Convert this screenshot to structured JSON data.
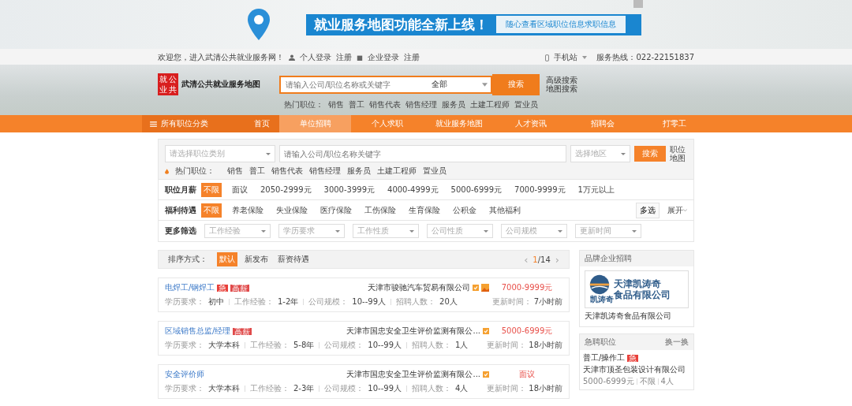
{
  "banner": {
    "headline": "就业服务地图功能全新上线！",
    "subline": "随心查看区域职位信息求职信息"
  },
  "topbar": {
    "welcome": "欢迎您，进入武清公共就业服务网！",
    "links": [
      {
        "label": "个人登录",
        "kind": "person"
      },
      {
        "label": "注册",
        "kind": "plain"
      },
      {
        "label": "企业登录",
        "kind": "company"
      },
      {
        "label": "注册",
        "kind": "plain"
      }
    ],
    "mobile": "手机站",
    "hotline": "服务热线：022-22151837"
  },
  "header": {
    "logo_chars": [
      "就",
      "公",
      "业",
      "共"
    ],
    "site_name": "武清公共就业服务地图",
    "search_placeholder": "请输入公司/职位名称或关键字",
    "scope": "全部",
    "search_button": "搜索",
    "links": [
      "高级搜索",
      "地图搜索"
    ],
    "hot_label": "热门职位：",
    "hot_tags": [
      "销售",
      "普工",
      "销售代表",
      "销售经理",
      "服务员",
      "土建工程师",
      "置业员"
    ]
  },
  "nav": {
    "category": "所有职位分类",
    "items": [
      {
        "label": "首页",
        "selected": false
      },
      {
        "label": "单位招聘",
        "selected": true
      },
      {
        "label": "个人求职",
        "selected": false
      },
      {
        "label": "就业服务地图",
        "selected": false
      },
      {
        "label": "人才资讯",
        "selected": false
      },
      {
        "label": "招聘会",
        "selected": false
      },
      {
        "label": "打零工",
        "selected": false
      }
    ]
  },
  "filters": {
    "category_placeholder": "请选择职位类别",
    "keyword_placeholder": "请输入公司/职位名称关键字",
    "region_placeholder": "选择地区",
    "search_button": "搜索",
    "map_link": "职位地图",
    "hot_label": "热门职位：",
    "hot_tags": [
      "销售",
      "普工",
      "销售代表",
      "销售经理",
      "服务员",
      "土建工程师",
      "置业员"
    ],
    "salary": {
      "label": "职位月薪",
      "options": [
        {
          "label": "不限",
          "selected": true
        },
        {
          "label": "面议",
          "selected": false
        },
        {
          "label": "2050-2999元",
          "selected": false
        },
        {
          "label": "3000-3999元",
          "selected": false
        },
        {
          "label": "4000-4999元",
          "selected": false
        },
        {
          "label": "5000-6999元",
          "selected": false
        },
        {
          "label": "7000-9999元",
          "selected": false
        },
        {
          "label": "1万元以上",
          "selected": false
        }
      ]
    },
    "welfare": {
      "label": "福利待遇",
      "options": [
        {
          "label": "不限",
          "selected": true
        },
        {
          "label": "养老保险",
          "selected": false
        },
        {
          "label": "失业保险",
          "selected": false
        },
        {
          "label": "医疗保险",
          "selected": false
        },
        {
          "label": "工伤保险",
          "selected": false
        },
        {
          "label": "生育保险",
          "selected": false
        },
        {
          "label": "公积金",
          "selected": false
        },
        {
          "label": "其他福利",
          "selected": false
        }
      ],
      "multi": "多选",
      "expand": "展开"
    },
    "more": {
      "label": "更多筛选",
      "selects": [
        "工作经验",
        "学历要求",
        "工作性质",
        "公司性质",
        "公司规模",
        "更新时间"
      ]
    }
  },
  "sort": {
    "label": "排序方式：",
    "options": [
      {
        "label": "默认",
        "selected": true
      },
      {
        "label": "新发布",
        "selected": false
      },
      {
        "label": "薪资待遇",
        "selected": false
      }
    ],
    "prev": "‹",
    "page_current": "1",
    "page_total": "/14",
    "next": "›"
  },
  "jobs": [
    {
      "title": "电焊工/钢焊工",
      "badges": [
        {
          "text": "急",
          "kind": "urgent"
        },
        {
          "text": "高薪",
          "kind": "hot"
        }
      ],
      "company": "天津市骏驰汽车贸易有限公司",
      "verified": true,
      "photo": true,
      "salary": "7000-9999元",
      "details": [
        {
          "label": "学历要求：",
          "value": "初中"
        },
        {
          "label": "工作经验：",
          "value": "1-2年"
        },
        {
          "label": "公司规模：",
          "value": "10--99人"
        },
        {
          "label": "招聘人数：",
          "value": "20人"
        }
      ],
      "updated_label": "更新时间：",
      "updated": "7小时前"
    },
    {
      "title": "区域销售总监/经理",
      "badges": [
        {
          "text": "高薪",
          "kind": "hot"
        }
      ],
      "company": "天津市国忠安全卫生评价监测有限公...",
      "verified": true,
      "salary": "5000-6999元",
      "details": [
        {
          "label": "学历要求：",
          "value": "大学本科"
        },
        {
          "label": "工作经验：",
          "value": "5-8年"
        },
        {
          "label": "公司规模：",
          "value": "10--99人"
        },
        {
          "label": "招聘人数：",
          "value": "1人"
        }
      ],
      "updated_label": "更新时间：",
      "updated": "18小时前"
    },
    {
      "title": "安全评价师",
      "company": "天津市国忠安全卫生评价监测有限公...",
      "verified": true,
      "salary": "面议",
      "details": [
        {
          "label": "学历要求：",
          "value": "大学本科"
        },
        {
          "label": "工作经验：",
          "value": "2-3年"
        },
        {
          "label": "公司规模：",
          "value": "10--99人"
        },
        {
          "label": "招聘人数：",
          "value": "4人"
        }
      ],
      "updated_label": "更新时间：",
      "updated": "18小时前"
    }
  ],
  "brand": {
    "title": "品牌企业招聘",
    "logo_lines": [
      "天津凯涛奇",
      "食品有限公司"
    ],
    "logo_caption": "凯涛奇",
    "company": "天津凯涛奇食品有限公司"
  },
  "urgent": {
    "title": "急聘职位",
    "action": "换一换",
    "items": [
      {
        "title": "普工/操作工",
        "badge": "急",
        "company": "天津市顶圣包装设计有限公司",
        "meta": [
          "5000-6999元",
          "不限",
          "4人"
        ]
      }
    ]
  }
}
